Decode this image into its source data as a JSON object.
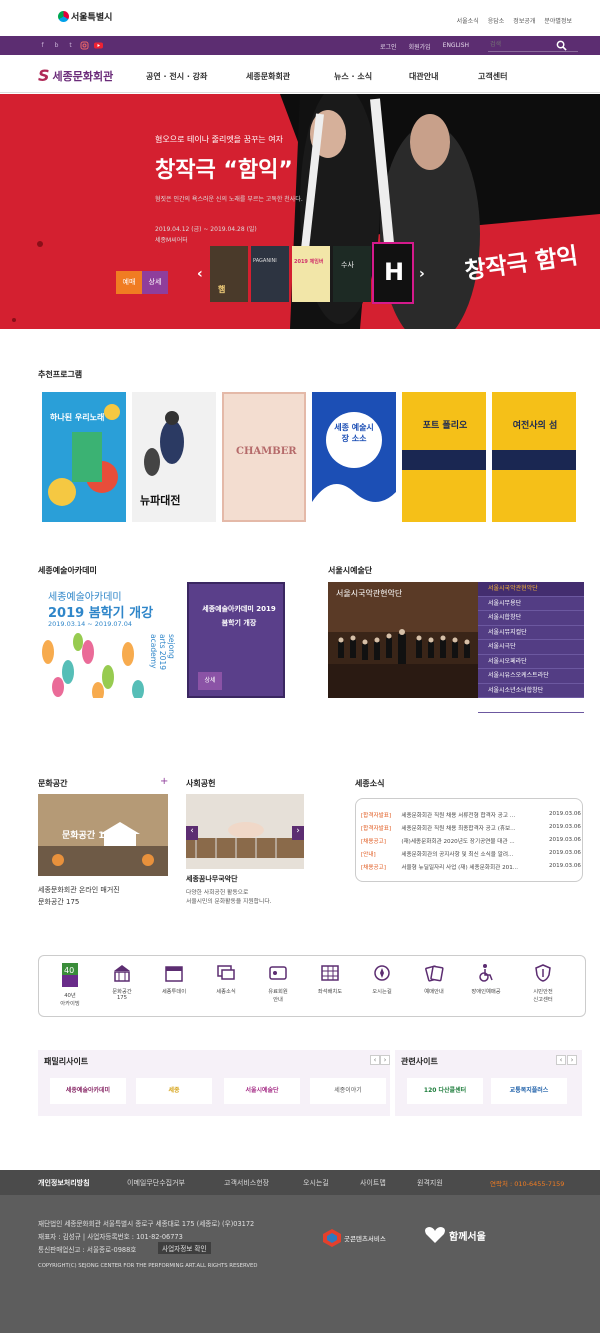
{
  "topbar": {
    "seoul": "서울특별시",
    "links": [
      "서울소식",
      "응답소",
      "정보공개",
      "분야별정보"
    ]
  },
  "purplebar": {
    "links": [
      "로그인",
      "회원가입",
      "ENGLISH"
    ],
    "search_placeholder": "검색"
  },
  "nav": {
    "logo": "세종문화회관",
    "items": [
      "공연 · 전시 · 강좌",
      "세종문화회관",
      "뉴스 · 소식",
      "대관안내",
      "고객센터"
    ]
  },
  "hero": {
    "subtitle": "혐오으로 테이나 줄리엣을 꿈꾸는 여자",
    "title": "창작극 “함익”",
    "desc": "혐짓은 인간의 욕스러운 신의 노래를 부르는 고독한 천사다.",
    "date": "2019.04.12 (금) ~ 2019.04.28 (일)",
    "venue": "세종M씨어터",
    "book": "예매",
    "detail": "상세",
    "brand": "창작극 함익",
    "thumbs": [
      "햄",
      "PAGANINI",
      "2019 체임버",
      "수사",
      "",
      "H"
    ]
  },
  "recommended": {
    "title": "추천프로그램",
    "posters": [
      "하나된 우리노래",
      "뉴파대전",
      "CHAMBER",
      "세종 예술시장 소소",
      "포트 폴리오",
      "여전사의 섬"
    ]
  },
  "academy": {
    "title": "세종예술아카데미",
    "img_text": "세종예술아카데미",
    "img_big": "2019 봄학기 개강",
    "img_date": "2019.03.14 ~ 2019.07.04",
    "img_side": "sejong arts 2019 academy",
    "box_text": "세종예술아카데미 2019 봄학기 개장",
    "detail": "상세"
  },
  "orchestra": {
    "title": "서울시예술단",
    "img_text": "서울시국악관현악단",
    "items": [
      "서울시국악관현악단",
      "서울시무용단",
      "서울시합창단",
      "서울시뮤지컬단",
      "서울시극단",
      "서울시오페라단",
      "서울시유스오케스트라단",
      "서울시소년소녀합창단",
      "서울시청소년국악단"
    ]
  },
  "culture": {
    "title": "문화공간",
    "plus": "+",
    "img_text": "문화공간 175",
    "caption1": "세종문화회관 온라인 매거진",
    "caption2": "문화공간 175"
  },
  "social": {
    "title": "사회공헌",
    "caption": "세종꿈나무국악단",
    "desc1": "다양한 사회공헌 활동으로",
    "desc2": "서울시민의 문화활동을 지원합니다."
  },
  "news": {
    "title": "세종소식",
    "rows": [
      {
        "cat": "[합격자발표]",
        "text": "세종문화회관 직원 채용 서류전형 합격자 공고 ...",
        "date": "2019.03.06"
      },
      {
        "cat": "[합격자발표]",
        "text": "세종문화회관 직원 채용 최종합격자 공고 (휴보...",
        "date": "2019.03.06"
      },
      {
        "cat": "[채용공고]",
        "text": "(재)세종문화회관 2020년도 장기공연물 대관 ...",
        "date": "2019.03.06"
      },
      {
        "cat": "[안내]",
        "text": "세종문화회관의 공지사항 및 최신 소식을 알려...",
        "date": "2019.03.06"
      },
      {
        "cat": "[채용공고]",
        "text": "서울형 뉴딜일자리 사업 (재) 세종문화회관 201...",
        "date": "2019.03.06"
      }
    ]
  },
  "quick": [
    {
      "label": "40년\n아카이빙",
      "icon": "archive-icon"
    },
    {
      "label": "문화공간\n175",
      "icon": "building-icon"
    },
    {
      "label": "세종투데이",
      "icon": "today-icon"
    },
    {
      "label": "세종소식",
      "icon": "chat-icon"
    },
    {
      "label": "유료회원\n안내",
      "icon": "card-icon"
    },
    {
      "label": "좌석배치도",
      "icon": "seat-icon"
    },
    {
      "label": "오시는길",
      "icon": "location-icon"
    },
    {
      "label": "예매안내",
      "icon": "ticket-icon"
    },
    {
      "label": "장애인예매공",
      "icon": "wheelchair-icon"
    },
    {
      "label": "시민안전\n신고센터",
      "icon": "shield-icon"
    }
  ],
  "family": {
    "title": "패밀리사이트",
    "logos": [
      "세종예술아카데미",
      "세종",
      "서울시예술단",
      "세종이야기"
    ]
  },
  "related": {
    "title": "관련사이트",
    "logos": [
      "120 다산콜센터",
      "교통복지플러스"
    ]
  },
  "footer": {
    "links": [
      "개인정보처리방침",
      "이메일무단수집거부",
      "고객서비스헌장",
      "오시는길",
      "사이트맵",
      "원격지원"
    ],
    "phone": "연락처 : 010-6455-7159",
    "addr": "재단법인 세종문화회관 서울특별시 종로구 세종대로 175 (세종로) (우)03172",
    "ceo": "재표자 : 김성규 | 사업자등록번호 : 101-82-06773",
    "sales": "통신판매업신고 : 서울종로-0988호",
    "verify": "사업자정보 확인",
    "copy": "COPYRIGHT(C) SEJONG CENTER FOR THE PERFORMING ART.ALL RIGHTS RESERVED",
    "partner1": "굿콘텐츠서비스",
    "partner2": "함께서울"
  },
  "colors": {
    "purple": "#5c2d71",
    "hero_red": "#d42030",
    "orange": "#f07c22"
  }
}
